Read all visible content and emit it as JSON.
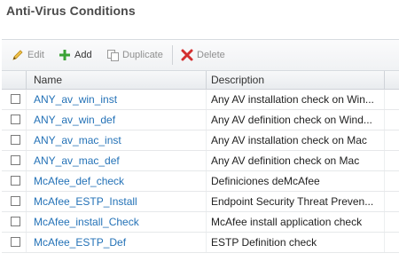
{
  "page": {
    "title": "Anti-Virus Conditions"
  },
  "toolbar": {
    "edit_label": "Edit",
    "add_label": "Add",
    "duplicate_label": "Duplicate",
    "delete_label": "Delete"
  },
  "table": {
    "columns": [
      "Name",
      "Description"
    ],
    "rows": [
      {
        "name": "ANY_av_win_inst",
        "description": "Any AV installation check on Win..."
      },
      {
        "name": "ANY_av_win_def",
        "description": "Any AV definition check on Wind..."
      },
      {
        "name": "ANY_av_mac_inst",
        "description": "Any AV installation check on Mac"
      },
      {
        "name": "ANY_av_mac_def",
        "description": "Any AV definition check on Mac"
      },
      {
        "name": "McAfee_def_check",
        "description": "Definiciones deMcAfee"
      },
      {
        "name": "McAfee_ESTP_Install",
        "description": "Endpoint Security Threat Preven..."
      },
      {
        "name": "McAfee_install_Check",
        "description": "McAfee install application check"
      },
      {
        "name": "McAfee_ESTP_Def",
        "description": "ESTP Definition check"
      }
    ]
  },
  "colors": {
    "link": "#2472b7",
    "add_icon": "#3aa335",
    "delete_icon": "#d32f2f",
    "edit_icon": "#e0a21c"
  }
}
